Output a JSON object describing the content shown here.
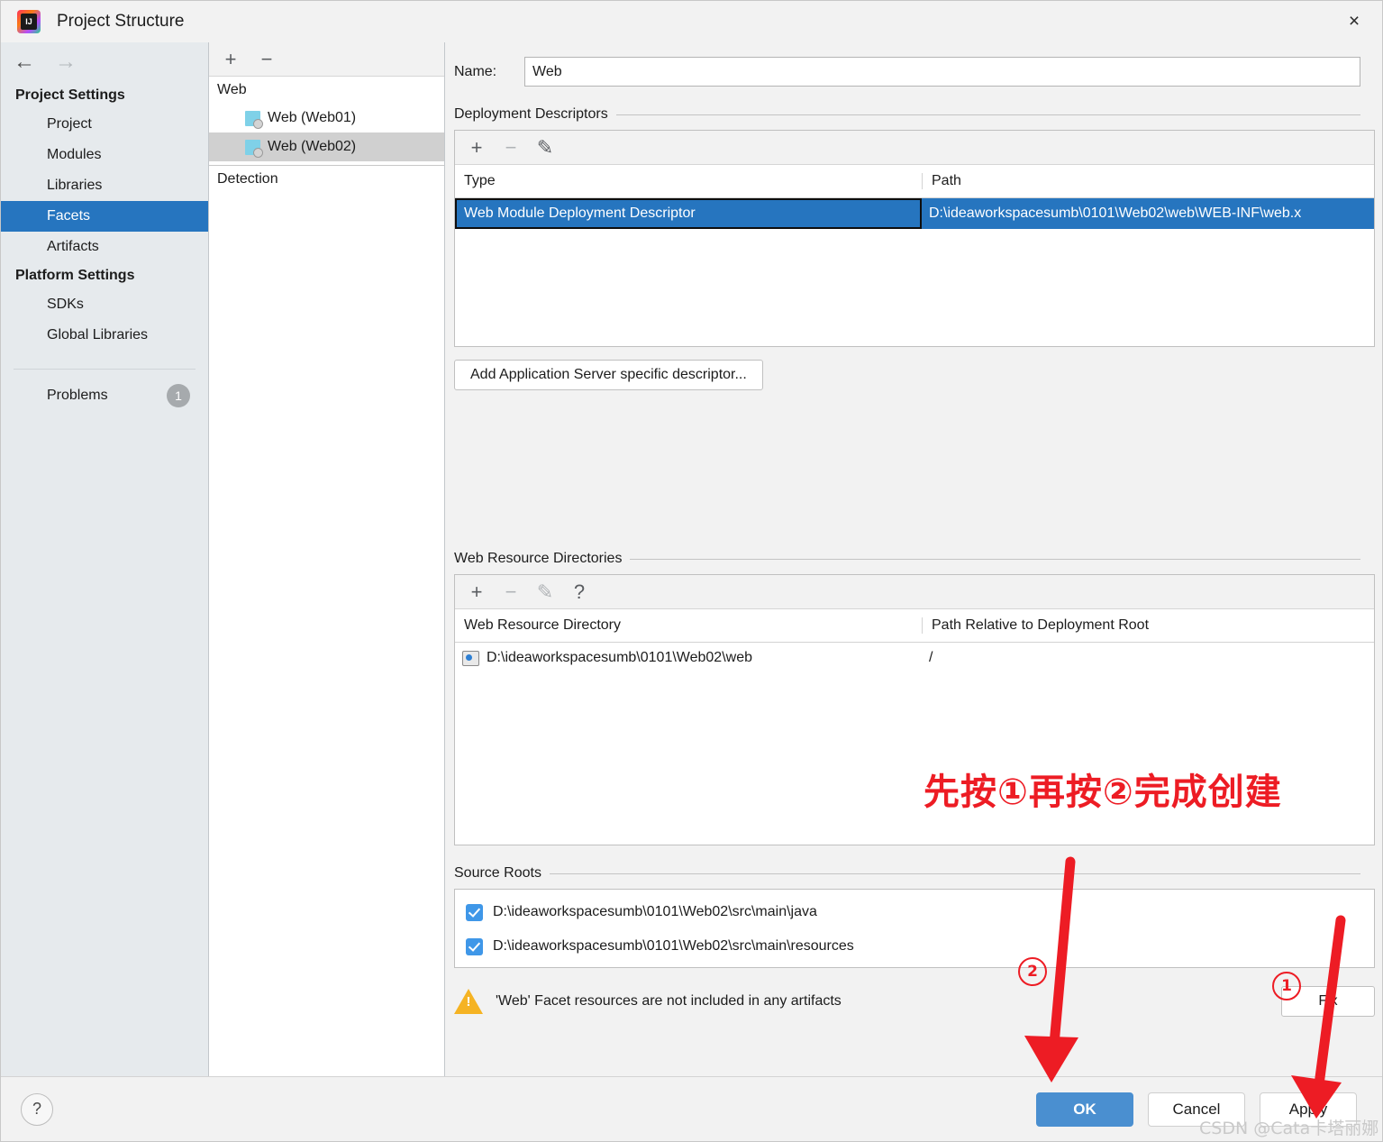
{
  "window": {
    "title": "Project Structure",
    "logo_icon": "intellij-idea-logo",
    "close_icon": "×"
  },
  "sidebar": {
    "back_icon": "←",
    "forward_icon": "→",
    "sections": [
      {
        "title": "Project Settings",
        "items": [
          {
            "label": "Project",
            "selected": false
          },
          {
            "label": "Modules",
            "selected": false
          },
          {
            "label": "Libraries",
            "selected": false
          },
          {
            "label": "Facets",
            "selected": true
          },
          {
            "label": "Artifacts",
            "selected": false
          }
        ]
      },
      {
        "title": "Platform Settings",
        "items": [
          {
            "label": "SDKs",
            "selected": false
          },
          {
            "label": "Global Libraries",
            "selected": false
          }
        ]
      }
    ],
    "problems": {
      "label": "Problems",
      "count": "1"
    }
  },
  "facet_tree": {
    "toolbar": {
      "add_icon": "+",
      "remove_icon": "−"
    },
    "group_label": "Web",
    "items": [
      {
        "label": "Web (Web01)",
        "selected": false
      },
      {
        "label": "Web (Web02)",
        "selected": true
      }
    ],
    "detection_label": "Detection"
  },
  "detail": {
    "name_label": "Name:",
    "name_value": "Web",
    "deployment_descriptors": {
      "title": "Deployment Descriptors",
      "toolbar": {
        "add_icon": "+",
        "remove_icon": "−",
        "edit_icon": "✎"
      },
      "columns": [
        "Type",
        "Path"
      ],
      "rows": [
        {
          "type": "Web Module Deployment Descriptor",
          "path": "D:\\ideaworkspacesumb\\0101\\Web02\\web\\WEB-INF\\web.x",
          "selected": true
        }
      ],
      "add_server_descriptor_label": "Add Application Server specific descriptor..."
    },
    "web_resource_directories": {
      "title": "Web Resource Directories",
      "toolbar": {
        "add_icon": "+",
        "remove_icon": "−",
        "edit_icon": "✎",
        "help_icon": "?"
      },
      "columns": [
        "Web Resource Directory",
        "Path Relative to Deployment Root"
      ],
      "rows": [
        {
          "directory": "D:\\ideaworkspacesumb\\0101\\Web02\\web",
          "relative_path": "/"
        }
      ]
    },
    "source_roots": {
      "title": "Source Roots",
      "items": [
        {
          "path": "D:\\ideaworkspacesumb\\0101\\Web02\\src\\main\\java",
          "checked": true
        },
        {
          "path": "D:\\ideaworkspacesumb\\0101\\Web02\\src\\main\\resources",
          "checked": true
        }
      ]
    },
    "warning": {
      "icon": "warning-triangle-icon",
      "text": "'Web' Facet resources are not included in any artifacts",
      "fix_label": "Fix"
    }
  },
  "footer": {
    "help_icon": "?",
    "ok_label": "OK",
    "cancel_label": "Cancel",
    "apply_label": "Apply"
  },
  "annotations": {
    "instruction": "先按①再按②完成创建",
    "marker_one": "①",
    "marker_two": "②",
    "marker_one_plain": "1",
    "marker_two_plain": "2",
    "color": "#ed1c24",
    "watermark": "CSDN @Cata卡塔丽娜"
  }
}
